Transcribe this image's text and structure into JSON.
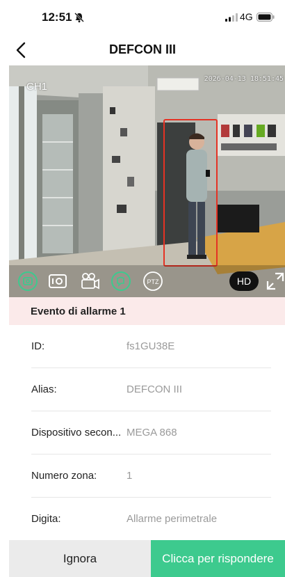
{
  "status_bar": {
    "time": "12:51",
    "network": "4G",
    "icons": [
      "bell-muted-icon",
      "signal-icon",
      "battery-icon"
    ]
  },
  "nav": {
    "title": "DEFCON III",
    "back_icon": "chevron-left-icon"
  },
  "video": {
    "channel": "CH1",
    "timestamp": "2026-04-13 18:51:45",
    "detection_color": "#e53224",
    "toolbar": {
      "icons": [
        "screenshot-icon",
        "record-icon",
        "video-camera-icon",
        "talk-icon",
        "ptz-icon",
        "fullscreen-icon"
      ],
      "ptz_label": "PTZ",
      "quality_label": "HD",
      "active_color": "#3dca8e"
    }
  },
  "alarm": {
    "title": "Evento di allarme 1",
    "fields": [
      {
        "label": "ID:",
        "value": "fs1GU38E"
      },
      {
        "label": "Alias:",
        "value": "DEFCON III"
      },
      {
        "label": "Dispositivo secon...",
        "value": "MEGA 868"
      },
      {
        "label": "Numero zona:",
        "value": "1"
      },
      {
        "label": "Digita:",
        "value": "Allarme perimetrale"
      }
    ]
  },
  "actions": {
    "ignore_label": "Ignora",
    "answer_label": "Clicca per rispondere",
    "answer_color": "#3dca8e"
  }
}
